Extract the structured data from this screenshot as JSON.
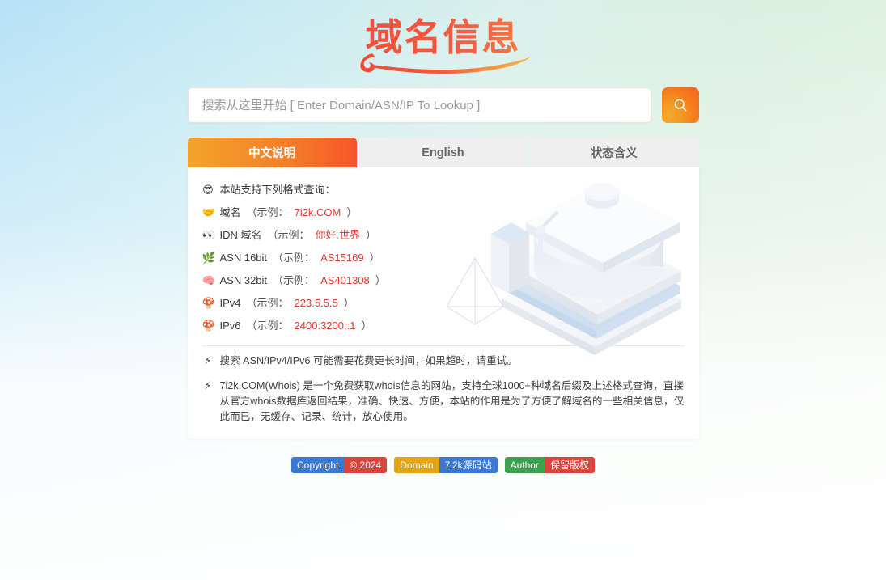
{
  "site": {
    "logo_text": "域名信息",
    "brand_red": "#f0503c",
    "brand_orange": "#f47a3e",
    "accent_example": "#e03a2f"
  },
  "search": {
    "placeholder": "搜索从这里开始 [ Enter Domain/ASN/IP To Lookup ]",
    "value": "",
    "button_icon": "search-icon",
    "button_label": "搜索"
  },
  "tabs": [
    {
      "label": "中文说明",
      "active": true
    },
    {
      "label": "English",
      "active": false
    },
    {
      "label": "状态含义",
      "active": false
    }
  ],
  "panel": {
    "intro": {
      "emoji": "😎",
      "icon": "sunglasses-face-icon",
      "text": "本站支持下列格式查询："
    },
    "formats": [
      {
        "emoji": "🤝",
        "icon": "handshake-icon",
        "label": "域名",
        "paren_open": "（示例：",
        "example": "7i2k.COM",
        "paren_close": "）"
      },
      {
        "emoji": "👀",
        "icon": "eyes-icon",
        "label": "IDN 域名",
        "paren_open": "（示例：",
        "example": "你好.世界",
        "paren_close": "）"
      },
      {
        "emoji": "🌿",
        "icon": "herb-icon",
        "label": "ASN 16bit",
        "paren_open": "（示例：",
        "example": "AS15169",
        "paren_close": "）"
      },
      {
        "emoji": "🧠",
        "icon": "brain-icon",
        "label": "ASN 32bit",
        "paren_open": "（示例：",
        "example": "AS401308",
        "paren_close": "）"
      },
      {
        "emoji": "🍄",
        "icon": "mushroom-grey-icon",
        "label": "IPv4",
        "paren_open": "（示例：",
        "example": "223.5.5.5",
        "paren_close": "）"
      },
      {
        "emoji": "🍄",
        "icon": "mushroom-red-icon",
        "label": "IPv6",
        "paren_open": "（示例：",
        "example": "2400:3200::1",
        "paren_close": "）"
      }
    ],
    "notes": [
      {
        "emoji": "⚡",
        "icon": "high-voltage-icon",
        "text": "搜索 ASN/IPv4/IPv6 可能需要花费更长时间，如果超时，请重试。"
      },
      {
        "emoji": "⚡",
        "icon": "high-voltage-icon",
        "text": "7i2k.COM(Whois) 是一个免费获取whois信息的网站，支持全球1000+种域名后缀及上述格式查询，直接从官方whois数据库返回结果，准确、快速、方便，本站的作用是为了方便了解域名的一些相关信息，仅此而已，无缓存、记录、统计，放心使用。"
      }
    ],
    "illustration": "isometric-stacked-plates-illustration"
  },
  "footer": {
    "badges": [
      {
        "name": "copyright-badge",
        "left_label": "Copyright",
        "right_label": "© 2024",
        "left_color": "#3a78d4",
        "right_color": "#d9443b"
      },
      {
        "name": "domain-badge",
        "left_label": "Domain",
        "right_label": "7i2k源码站",
        "left_color": "#e3a513",
        "right_color": "#3a78d4"
      },
      {
        "name": "author-badge",
        "left_label": "Author",
        "right_label": "保留版权",
        "left_color": "#3fa050",
        "right_color": "#d9443b"
      }
    ]
  }
}
